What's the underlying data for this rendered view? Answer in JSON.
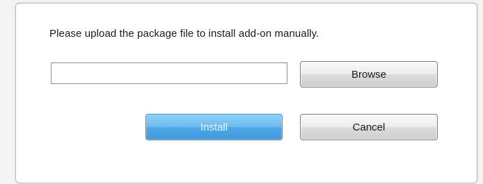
{
  "dialog": {
    "message": "Please upload the package file to install add-on manually.",
    "file_input": {
      "value": "",
      "placeholder": ""
    },
    "buttons": {
      "browse_label": "Browse",
      "install_label": "Install",
      "cancel_label": "Cancel"
    },
    "colors": {
      "install_button": "#4ea8e6",
      "default_button": "#e6e6e6"
    }
  }
}
